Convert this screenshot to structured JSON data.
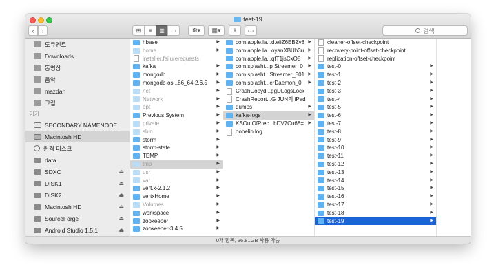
{
  "window": {
    "title": "test-19"
  },
  "toolbar": {
    "back": "‹",
    "forward": "›",
    "view_icons": [
      "⊞",
      "≡",
      "▥",
      "▭"
    ],
    "action": "✻▾",
    "arrange": "▦▾",
    "share": "⇪",
    "tag": "▭",
    "search_placeholder": "검색"
  },
  "sidebar": {
    "favorites": [
      {
        "label": "도큐멘트",
        "icon": "documents-icon"
      },
      {
        "label": "Downloads",
        "icon": "downloads-icon"
      },
      {
        "label": "동영상",
        "icon": "movies-icon"
      },
      {
        "label": "음악",
        "icon": "music-icon"
      },
      {
        "label": "mazdah",
        "icon": "home-icon"
      },
      {
        "label": "그림",
        "icon": "pictures-icon"
      }
    ],
    "devices_heading": "기기",
    "devices": [
      {
        "label": "SECONDARY NAMENODE",
        "icon": "network-icon",
        "eject": ""
      },
      {
        "label": "Macintosh HD",
        "icon": "hard-disk-icon",
        "eject": "",
        "active": true
      },
      {
        "label": "원격 디스크",
        "icon": "remote-disk-icon",
        "eject": ""
      },
      {
        "label": "data",
        "icon": "disk-icon",
        "eject": ""
      },
      {
        "label": "SDXC",
        "icon": "disk-icon",
        "eject": "⏏"
      },
      {
        "label": "DISK1",
        "icon": "disk-icon",
        "eject": "⏏"
      },
      {
        "label": "DISK2",
        "icon": "disk-icon",
        "eject": "⏏"
      },
      {
        "label": "Macintosh HD",
        "icon": "disk-icon",
        "eject": "⏏"
      },
      {
        "label": "SourceForge",
        "icon": "disk-icon",
        "eject": "⏏"
      },
      {
        "label": "Android Studio 1.5.1",
        "icon": "disk-icon",
        "eject": "⏏"
      }
    ]
  },
  "column1": [
    {
      "label": "hbase",
      "type": "folder",
      "arrow": true
    },
    {
      "label": "home",
      "type": "folder",
      "dim": true,
      "arrow": true
    },
    {
      "label": "installer.failurerequests",
      "type": "doc",
      "dim": true
    },
    {
      "label": "kafka",
      "type": "folder",
      "arrow": true
    },
    {
      "label": "mongodb",
      "type": "folder",
      "arrow": true
    },
    {
      "label": "mongodb-os...86_64-2.6.5",
      "type": "folder",
      "arrow": true
    },
    {
      "label": "net",
      "type": "folder",
      "dim": true,
      "arrow": true
    },
    {
      "label": "Network",
      "type": "folder",
      "dim": true,
      "arrow": true
    },
    {
      "label": "opt",
      "type": "folder",
      "dim": true,
      "arrow": true
    },
    {
      "label": "Previous System",
      "type": "folder",
      "arrow": true
    },
    {
      "label": "private",
      "type": "folder",
      "dim": true,
      "arrow": true
    },
    {
      "label": "sbin",
      "type": "folder",
      "dim": true,
      "arrow": true
    },
    {
      "label": "storm",
      "type": "folder",
      "arrow": true
    },
    {
      "label": "storm-state",
      "type": "folder",
      "arrow": true
    },
    {
      "label": "TEMP",
      "type": "folder",
      "arrow": true
    },
    {
      "label": "tmp",
      "type": "alias",
      "dim": true,
      "arrow": true,
      "selected": true
    },
    {
      "label": "usr",
      "type": "folder",
      "dim": true,
      "arrow": true
    },
    {
      "label": "var",
      "type": "folder",
      "dim": true,
      "arrow": true
    },
    {
      "label": "vert.x-2.1.2",
      "type": "folder",
      "arrow": true
    },
    {
      "label": "vertxHome",
      "type": "folder",
      "arrow": true
    },
    {
      "label": "Volumes",
      "type": "folder",
      "dim": true,
      "arrow": true
    },
    {
      "label": "workspace",
      "type": "folder",
      "arrow": true
    },
    {
      "label": "zookeeper",
      "type": "folder",
      "arrow": true
    },
    {
      "label": "zookeeper-3.4.5",
      "type": "folder",
      "arrow": true
    }
  ],
  "column2": [
    {
      "label": "com.apple.la...d.eliZ6EBZv8",
      "type": "folder",
      "arrow": true
    },
    {
      "label": "com.apple.la...oyanXBUh3u",
      "type": "folder",
      "arrow": true
    },
    {
      "label": "com.apple.la...qfT1jsCxO8",
      "type": "folder",
      "arrow": true
    },
    {
      "label": "com.splasht...p Streamer_0",
      "type": "folder",
      "arrow": true
    },
    {
      "label": "com.splasht...Streamer_501",
      "type": "folder",
      "arrow": true
    },
    {
      "label": "com.splasht...erDaemon_0",
      "type": "folder",
      "arrow": true
    },
    {
      "label": "CrashCopyd...ggDLogsLock",
      "type": "doc"
    },
    {
      "label": "CrashReport...G JUN의 iPad",
      "type": "doc"
    },
    {
      "label": "dumps",
      "type": "folder",
      "arrow": true
    },
    {
      "label": "kafka-logs",
      "type": "folder",
      "arrow": true,
      "selected": true
    },
    {
      "label": "KSOutOfPrec...bDV7Cu68=",
      "type": "folder",
      "arrow": true
    },
    {
      "label": "oobelib.log",
      "type": "doc"
    }
  ],
  "column3": [
    {
      "label": "cleaner-offset-checkpoint",
      "type": "doc"
    },
    {
      "label": "recovery-point-offset-checkpoint",
      "type": "doc"
    },
    {
      "label": "replication-offset-checkpoint",
      "type": "doc"
    },
    {
      "label": "test-0",
      "type": "folder",
      "arrow": true
    },
    {
      "label": "test-1",
      "type": "folder",
      "arrow": true
    },
    {
      "label": "test-2",
      "type": "folder",
      "arrow": true
    },
    {
      "label": "test-3",
      "type": "folder",
      "arrow": true
    },
    {
      "label": "test-4",
      "type": "folder",
      "arrow": true
    },
    {
      "label": "test-5",
      "type": "folder",
      "arrow": true
    },
    {
      "label": "test-6",
      "type": "folder",
      "arrow": true
    },
    {
      "label": "test-7",
      "type": "folder",
      "arrow": true
    },
    {
      "label": "test-8",
      "type": "folder",
      "arrow": true
    },
    {
      "label": "test-9",
      "type": "folder",
      "arrow": true
    },
    {
      "label": "test-10",
      "type": "folder",
      "arrow": true
    },
    {
      "label": "test-11",
      "type": "folder",
      "arrow": true
    },
    {
      "label": "test-12",
      "type": "folder",
      "arrow": true
    },
    {
      "label": "test-13",
      "type": "folder",
      "arrow": true
    },
    {
      "label": "test-14",
      "type": "folder",
      "arrow": true
    },
    {
      "label": "test-15",
      "type": "folder",
      "arrow": true
    },
    {
      "label": "test-16",
      "type": "folder",
      "arrow": true
    },
    {
      "label": "test-17",
      "type": "folder",
      "arrow": true
    },
    {
      "label": "test-18",
      "type": "folder",
      "arrow": true
    },
    {
      "label": "test-19",
      "type": "folder",
      "arrow": true,
      "active": true
    }
  ],
  "statusbar": {
    "text": "0개 항목, 36.81GB 사용 가능"
  }
}
